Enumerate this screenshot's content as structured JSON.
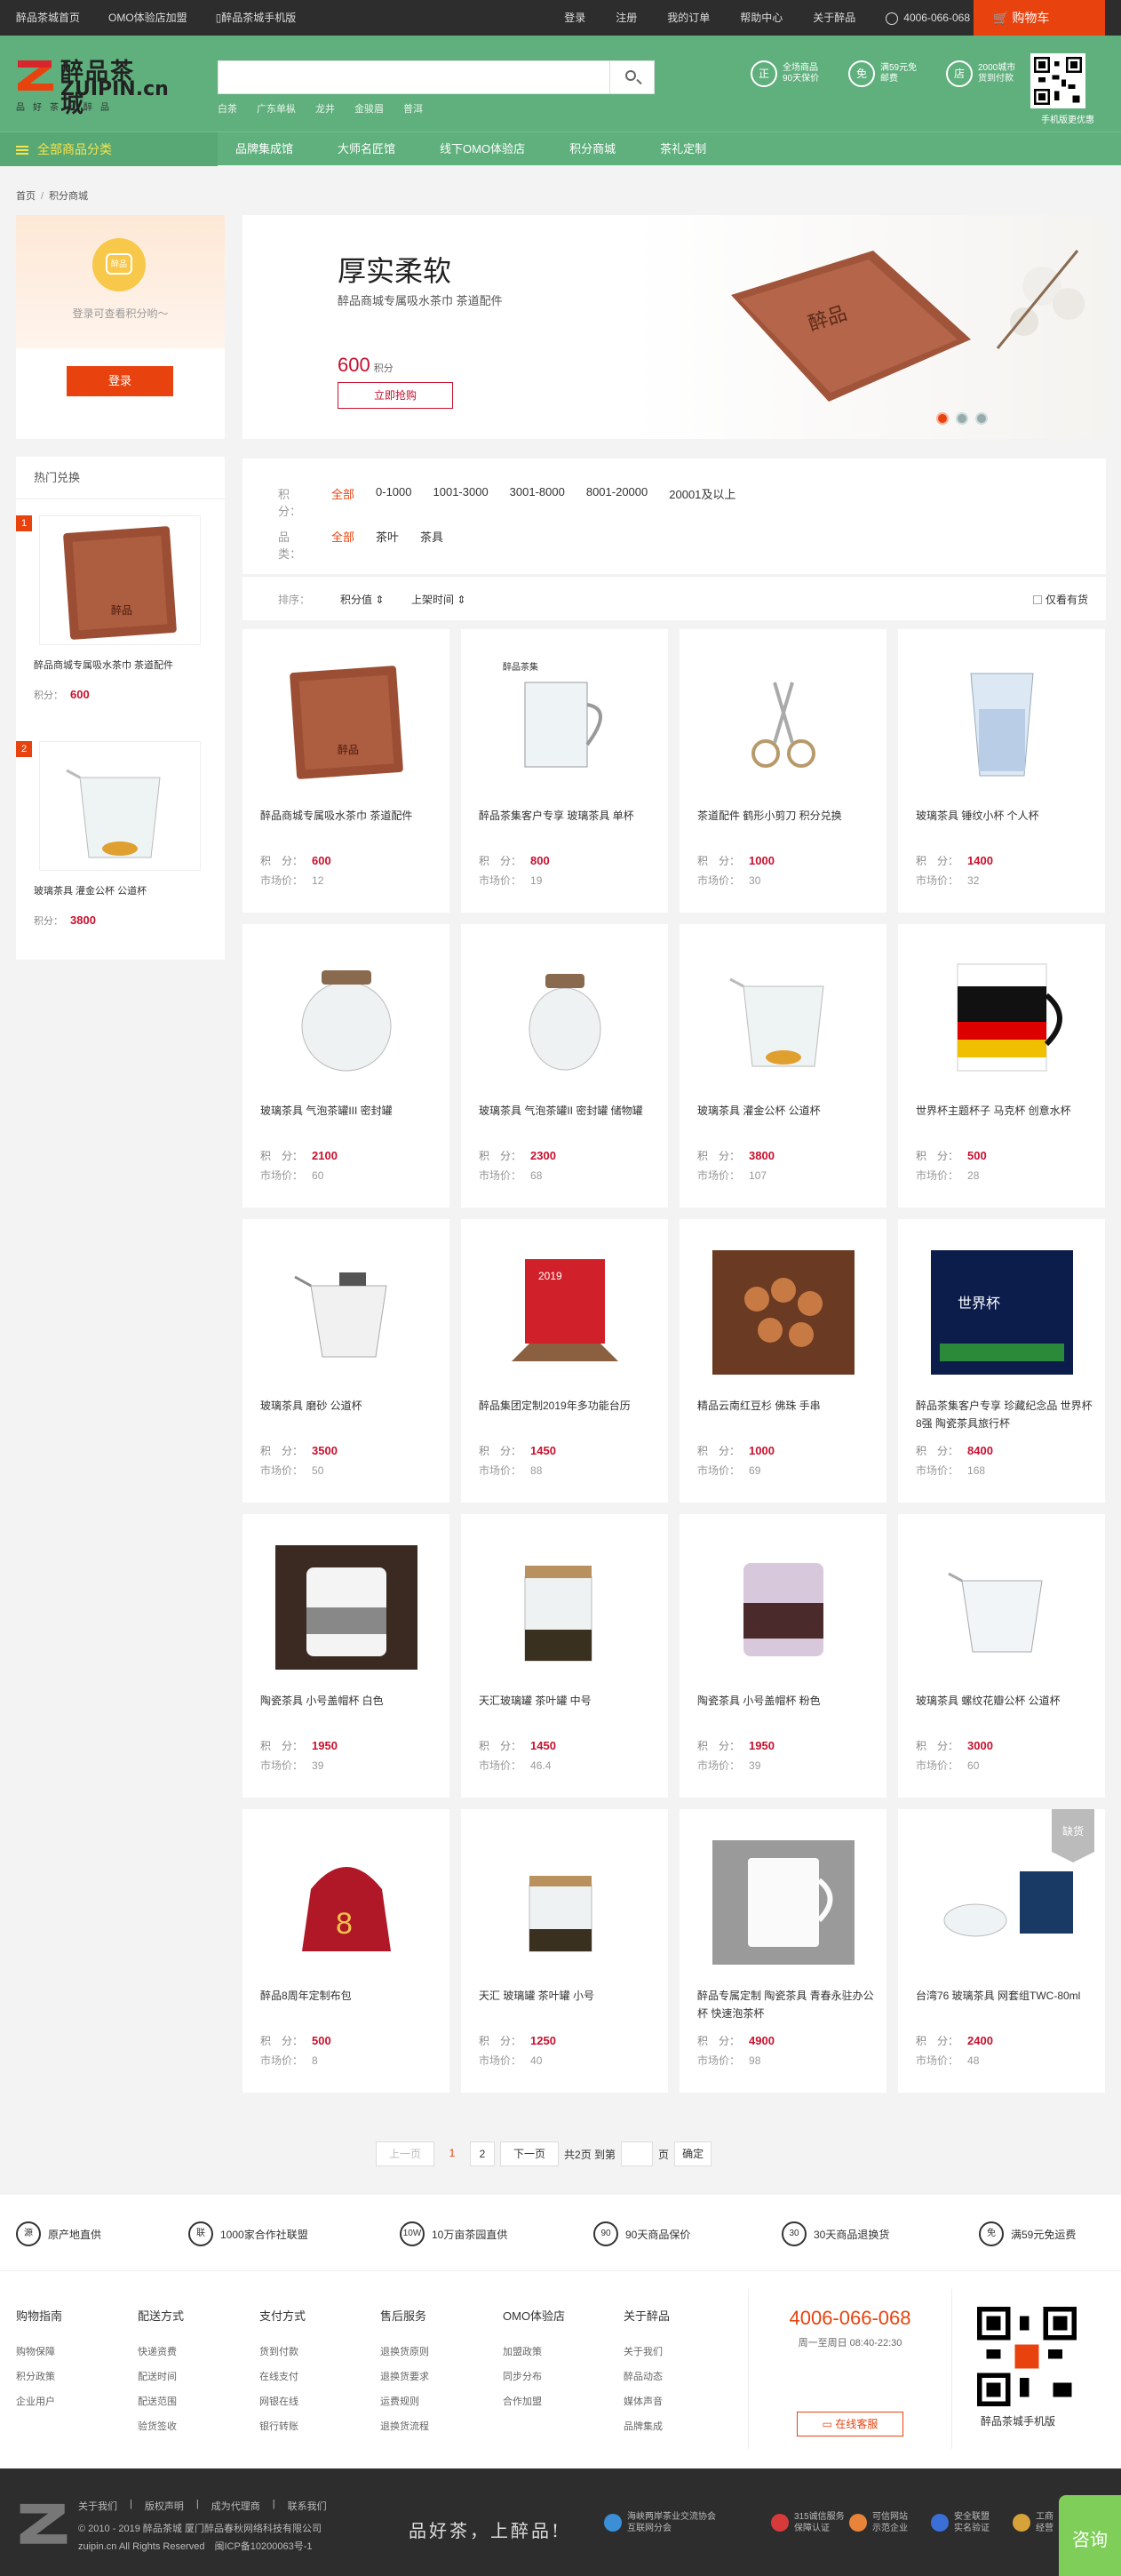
{
  "topbar": {
    "left_links": [
      "醉品茶城首页",
      "OMO体验店加盟",
      "醉品茶城手机版"
    ],
    "right_links": [
      "登录",
      "注册",
      "我的订单",
      "帮助中心",
      "关于醉品"
    ],
    "phone": "4006-066-068",
    "cart": "购物车"
  },
  "logo": {
    "cn": "醉品茶城",
    "en": "ZUIPIN.cn",
    "slogan": "品好茶上醉品"
  },
  "search": {
    "placeholder": "",
    "hotwords": [
      "白茶",
      "广东单枞",
      "龙井",
      "金骏眉",
      "普洱"
    ]
  },
  "guarantees": [
    {
      "icon": "正",
      "line1": "全场商品",
      "line2": "90天保价"
    },
    {
      "icon": "免",
      "line1": "满59元免",
      "line2": "邮费"
    },
    {
      "icon": "店",
      "line1": "2000城市",
      "line2": "货到付款"
    }
  ],
  "qr_label": "手机版更优惠",
  "nav": {
    "all": "全部商品分类",
    "items": [
      "品牌集成馆",
      "大师名匠馆",
      "线下OMO体验店",
      "积分商城",
      "茶礼定制"
    ]
  },
  "breadcrumb": [
    "首页",
    "积分商城"
  ],
  "login": {
    "hint": "登录可查看积分哟～",
    "button": "登录",
    "avatar_text": "醉品"
  },
  "hot": {
    "title": "热门兑换",
    "points_label": "积分：",
    "items": [
      {
        "rank": "1",
        "name": "醉品商城专属吸水茶巾 茶道配件",
        "points": "600",
        "img": "towel"
      },
      {
        "rank": "2",
        "name": "玻璃茶具 灌金公杯 公道杯",
        "points": "3800",
        "img": "pitcher"
      }
    ]
  },
  "banner": {
    "title": "厚实柔软",
    "subtitle": "醉品商城专属吸水茶巾 茶道配件",
    "price": "600",
    "price_unit": "积分",
    "button": "立即抢购"
  },
  "filter": {
    "points_label": "积分：",
    "points_options": [
      "全部",
      "0-1000",
      "1001-3000",
      "3001-8000",
      "8001-20000",
      "20001及以上"
    ],
    "category_label": "品类：",
    "category_options": [
      "全部",
      "茶叶",
      "茶具"
    ],
    "sort_label": "排序：",
    "sort_options": [
      "积分值",
      "上架时间"
    ],
    "only_stock": "仅看有货"
  },
  "labels": {
    "points": "积　分：",
    "market": "市场价："
  },
  "products": [
    {
      "name": "醉品商城专属吸水茶巾 茶道配件",
      "points": "600",
      "market": "12",
      "img": "towel"
    },
    {
      "name": "醉品茶集客户专享 玻璃茶具 单杯",
      "points": "800",
      "market": "19",
      "img": "glassmug"
    },
    {
      "name": "茶道配件 鹤形小剪刀 积分兑换",
      "points": "1000",
      "market": "30",
      "img": "scissors"
    },
    {
      "name": "玻璃茶具 锤纹小杯 个人杯",
      "points": "1400",
      "market": "32",
      "img": "hammered"
    },
    {
      "name": "玻璃茶具 气泡茶罐III 密封罐",
      "points": "2100",
      "market": "60",
      "img": "jar"
    },
    {
      "name": "玻璃茶具 气泡茶罐II 密封罐 储物罐",
      "points": "2300",
      "market": "68",
      "img": "jar2"
    },
    {
      "name": "玻璃茶具 灌金公杯 公道杯",
      "points": "3800",
      "market": "107",
      "img": "pitcher"
    },
    {
      "name": "世界杯主题杯子 马克杯 创意水杯",
      "points": "500",
      "market": "28",
      "img": "wcmug"
    },
    {
      "name": "玻璃茶具 磨砂 公道杯",
      "points": "3500",
      "market": "50",
      "img": "frosted"
    },
    {
      "name": "醉品集团定制2019年多功能台历",
      "points": "1450",
      "market": "88",
      "img": "calendar"
    },
    {
      "name": "精品云南红豆杉 佛珠 手串",
      "points": "1000",
      "market": "69",
      "img": "beads"
    },
    {
      "name": "醉品茶集客户专享 珍藏纪念品 世界杯8强 陶瓷茶具旅行杯",
      "points": "8400",
      "market": "168",
      "img": "wcset"
    },
    {
      "name": "陶瓷茶具 小号盖帽杯 白色",
      "points": "1950",
      "market": "39",
      "img": "capwhite"
    },
    {
      "name": "天汇玻璃罐 茶叶罐 中号",
      "points": "1450",
      "market": "46.4",
      "img": "teajar"
    },
    {
      "name": "陶瓷茶具 小号盖帽杯 粉色",
      "points": "1950",
      "market": "39",
      "img": "cappink"
    },
    {
      "name": "玻璃茶具 螺纹花瓣公杯 公道杯",
      "points": "3000",
      "market": "60",
      "img": "petal"
    },
    {
      "name": "醉品8周年定制布包",
      "points": "500",
      "market": "8",
      "img": "bag"
    },
    {
      "name": "天汇 玻璃罐 茶叶罐 小号",
      "points": "1250",
      "market": "40",
      "img": "teajar2"
    },
    {
      "name": "醉品专属定制 陶瓷茶具 青春永驻办公杯 快速泡茶杯",
      "points": "4900",
      "market": "98",
      "img": "office"
    },
    {
      "name": "台湾76 玻璃茶具 网套组TWC-80ml",
      "points": "2400",
      "market": "48",
      "img": "twset",
      "soldout": "缺货"
    }
  ],
  "pager": {
    "prev": "上一页",
    "pages": [
      "1",
      "2"
    ],
    "next": "下一页",
    "total": "共2页 到第",
    "page_unit": "页",
    "ok": "确定"
  },
  "services": [
    {
      "icon": "源",
      "text": "原产地直供"
    },
    {
      "icon": "联",
      "text": "1000家合作社联盟"
    },
    {
      "icon": "10W",
      "text": "10万亩茶园直供"
    },
    {
      "icon": "90",
      "text": "90天商品保价"
    },
    {
      "icon": "30",
      "text": "30天商品退换货"
    },
    {
      "icon": "免",
      "text": "满59元免运费"
    }
  ],
  "footer_cols": [
    {
      "title": "购物指南",
      "links": [
        "购物保障",
        "积分政策",
        "企业用户"
      ]
    },
    {
      "title": "配送方式",
      "links": [
        "快递资费",
        "配送时间",
        "配送范围",
        "验货签收"
      ]
    },
    {
      "title": "支付方式",
      "links": [
        "货到付款",
        "在线支付",
        "网银在线",
        "银行转账"
      ]
    },
    {
      "title": "售后服务",
      "links": [
        "退换货原则",
        "退换货要求",
        "运费规则",
        "退换货流程"
      ]
    },
    {
      "title": "OMO体验店",
      "links": [
        "加盟政策",
        "同步分布",
        "合作加盟"
      ]
    },
    {
      "title": "关于醉品",
      "links": [
        "关于我们",
        "醉品动态",
        "媒体声音",
        "品牌集成"
      ]
    }
  ],
  "contact": {
    "tel": "4006-066-068",
    "hours": "周一至周日 08:40-22:30",
    "button": "在线客服"
  },
  "footer_qr_label": "醉品茶城手机版",
  "bottom": {
    "links": [
      "关于我们",
      "|",
      "版权声明",
      "|",
      "成为代理商",
      "|",
      "联系我们"
    ],
    "copy1": "© 2010 - 2019 醉品茶城 厦门醉品春秋网络科技有限公司",
    "copy2": "zuipin.cn All Rights Reserved　闽ICP备10200063号-1",
    "motto": "品好茶，上醉品!",
    "badges": [
      {
        "l1": "海峡两岸茶业交流协会",
        "l2": "互联网分会",
        "color": "#3a8fd6"
      },
      {
        "l1": "315诚信服务",
        "l2": "保障认证",
        "color": "#d63a3a"
      },
      {
        "l1": "可信网站",
        "l2": "示范企业",
        "color": "#e8843a"
      },
      {
        "l1": "安全联盟",
        "l2": "实名验证",
        "color": "#3a6fd6"
      },
      {
        "l1": "工商",
        "l2": "经营",
        "color": "#d6a33a"
      }
    ],
    "float": "咨询"
  },
  "colors": {
    "brand_green": "#5fb07d",
    "accent_orange": "#e8430f",
    "price_red": "#c8102e"
  }
}
